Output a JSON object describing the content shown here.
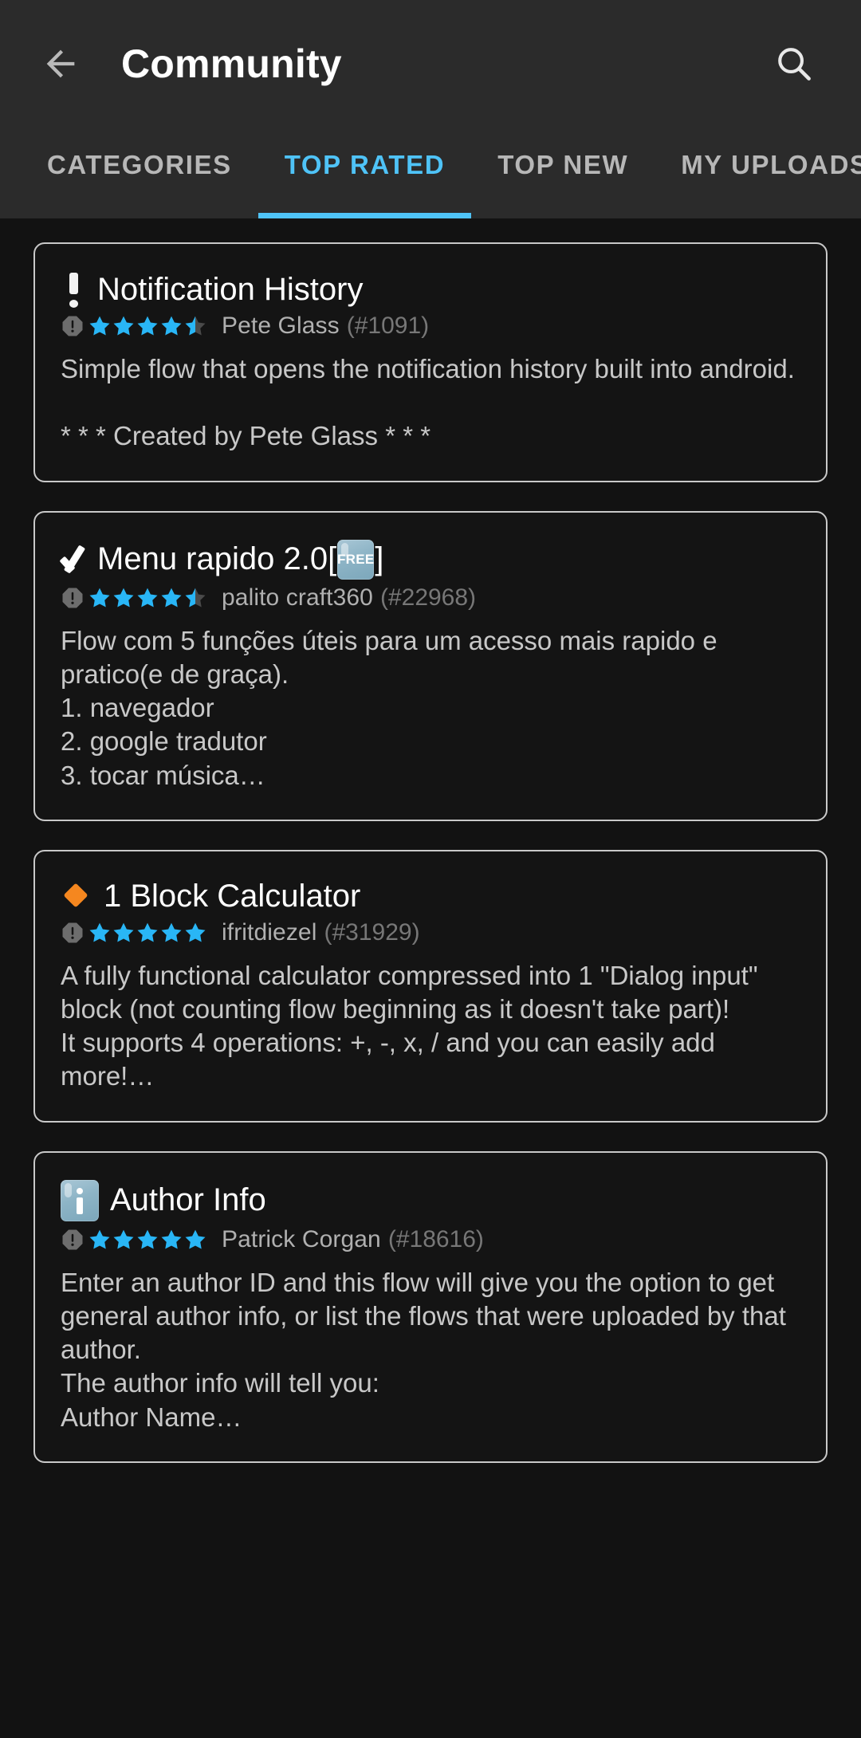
{
  "header": {
    "title": "Community",
    "back_icon": "arrow-left-icon",
    "search_icon": "search-icon"
  },
  "tabs": [
    {
      "label": "CATEGORIES",
      "active": false
    },
    {
      "label": "TOP RATED",
      "active": true
    },
    {
      "label": "TOP NEW",
      "active": false
    },
    {
      "label": "MY UPLOADS",
      "active": false
    }
  ],
  "colors": {
    "accent": "#4fc3f7",
    "appbar_bg": "#2b2b2b",
    "page_bg": "#121212",
    "card_border": "#c9c9c9",
    "star": "#29b6f6",
    "star_empty": "#4a4a4a",
    "title_text": "#ffffff",
    "desc_text": "#c8c8c8",
    "author_text": "#b0b0b0",
    "author_id_text": "#777777",
    "diamond_orange": "#f5871f",
    "emoji_badge_blue": "#8db4c6"
  },
  "cards": [
    {
      "emoji": "exclamation-mark-emoji",
      "title": "Notification History",
      "rating": 4.5,
      "author": "Pete Glass",
      "author_id": "(#1091)",
      "description": "Simple flow that opens the notification history built into android.\n\n* * * Created by Pete Glass * * *"
    },
    {
      "emoji": "heavy-check-mark-emoji",
      "title": "Menu rapido 2.0[",
      "title_badge": "FREE",
      "title_suffix": "]",
      "rating": 4.5,
      "author": "palito craft360",
      "author_id": "(#22968)",
      "description": "Flow com 5 funções úteis para um acesso mais rapido e pratico(e de graça).\n1. navegador\n2. google tradutor\n3. tocar música…"
    },
    {
      "emoji": "small-orange-diamond-emoji",
      "title": "1 Block Calculator",
      "rating": 5,
      "author": "ifritdiezel",
      "author_id": "(#31929)",
      "description": "A fully functional calculator compressed into 1 \"Dialog input\" block (not counting flow beginning as it doesn't take part)!\nIt supports 4 operations: +, -, x, / and you can easily add more!…"
    },
    {
      "emoji": "information-source-emoji",
      "title": "Author Info",
      "rating": 5,
      "author": "Patrick Corgan",
      "author_id": "(#18616)",
      "description": "Enter an author ID and this flow will give you the option to get general author info, or list the flows that were uploaded by that author.\nThe author info will tell you:\nAuthor Name…"
    }
  ]
}
